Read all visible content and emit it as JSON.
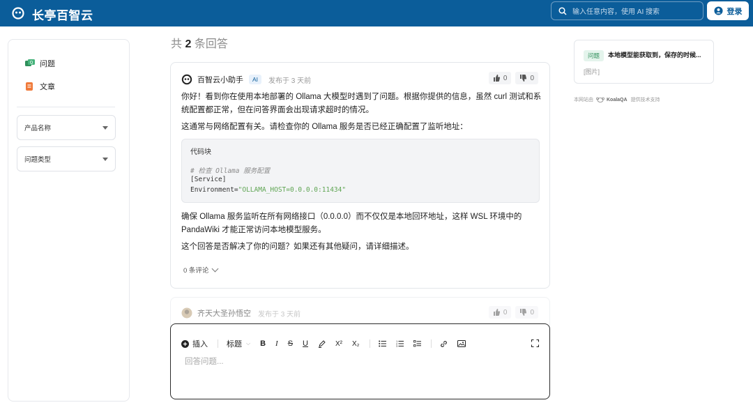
{
  "header": {
    "brand": "长亭百智云",
    "search_placeholder": "输入任意内容，使用 AI 搜索",
    "login_label": "登录",
    "bg_color": "#0b5d9a"
  },
  "sidebar": {
    "nav": [
      {
        "label": "问题",
        "icon": "question-icon"
      },
      {
        "label": "文章",
        "icon": "article-icon"
      }
    ],
    "filters": [
      {
        "label": "产品名称"
      },
      {
        "label": "问题类型"
      }
    ]
  },
  "main": {
    "heading_prefix": "共",
    "answer_count": "2",
    "heading_suffix": "条回答",
    "answer": {
      "author": "百智云小助手",
      "badge": "AI",
      "posted": "发布于 3 天前",
      "likes": "0",
      "dislikes": "0",
      "p1": "你好！看到你在使用本地部署的 Ollama 大模型时遇到了问题。根据你提供的信息，虽然 curl 测试和系统配置都正常，但在问答界面会出现请求超时的情况。",
      "p2": "这通常与网络配置有关。请检查你的 Ollama 服务是否已经正确配置了监听地址：",
      "code_title": "代码块",
      "code_comment": "# 检查 Ollama 服务配置",
      "code_line2": "[Service]",
      "code_key": "Environment=",
      "code_value": "\"OLLAMA_HOST=0.0.0.0:11434\"",
      "p3": "确保 Ollama 服务监听在所有网络接口（0.0.0.0）而不仅仅是本地回环地址，这样 WSL 环境中的 PandaWiki 才能正常访问本地模型服务。",
      "p4": "这个回答是否解决了你的问题？如果还有其他疑问，请详细描述。",
      "comments": "0 条评论"
    },
    "answer2": {
      "author": "齐天大圣孙悟空",
      "posted": "发布于 3 天前",
      "likes": "0",
      "dislikes": "0"
    },
    "editor": {
      "insert_label": "插入",
      "heading_label": "标题",
      "bold": "B",
      "italic": "I",
      "strike": "S",
      "underline": "U",
      "sup": "X²",
      "sub": "X₂",
      "placeholder": "回答问题..."
    }
  },
  "right": {
    "related_badge": "问题",
    "related_title": "本地模型能获取到，保存的时候...",
    "related_sub": "[图片]",
    "powered_prefix": "本网站由",
    "powered_brand": "KoalaQA",
    "powered_suffix": "提供技术支持"
  }
}
